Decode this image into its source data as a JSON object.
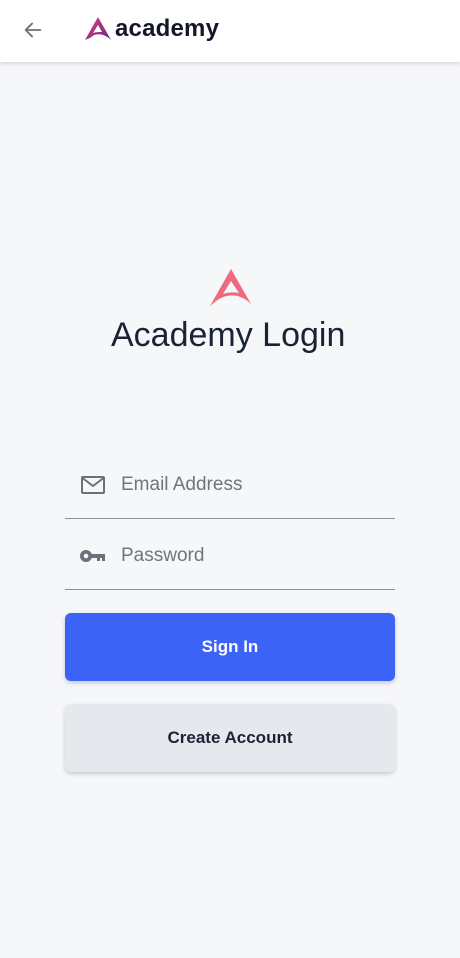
{
  "topbar": {
    "back_icon": "arrow-left-icon",
    "brand_name": "academy",
    "brand_colors": [
      "#5b2a86",
      "#e8407a"
    ]
  },
  "hero": {
    "logo_icon": "academy-logo-icon",
    "logo_color": "#ef6a7f",
    "title": "Academy Login"
  },
  "form": {
    "email": {
      "icon": "mail-icon",
      "placeholder": "Email Address",
      "value": ""
    },
    "password": {
      "icon": "key-icon",
      "placeholder": "Password",
      "value": ""
    }
  },
  "actions": {
    "sign_in_label": "Sign In",
    "sign_in_color": "#3b63f6",
    "create_account_label": "Create Account"
  }
}
